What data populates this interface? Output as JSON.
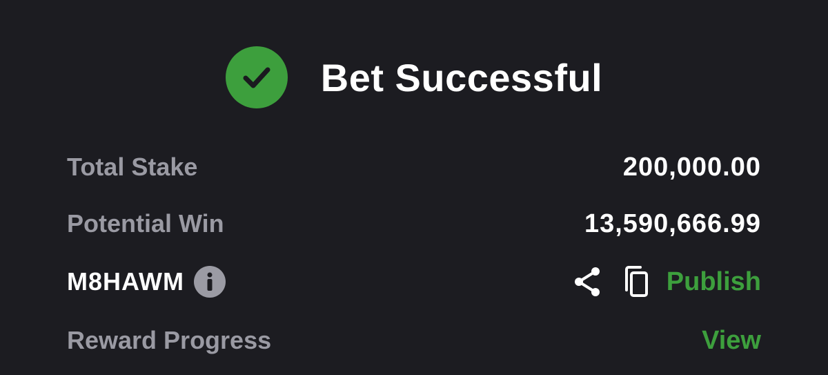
{
  "header": {
    "title": "Bet Successful",
    "icon": "check-circle-icon",
    "accent_color": "#3d9f3d"
  },
  "details": {
    "total_stake_label": "Total Stake",
    "total_stake_value": "200,000.00",
    "potential_win_label": "Potential Win",
    "potential_win_value": "13,590,666.99",
    "booking_code": "M8HAWM",
    "publish_label": "Publish",
    "reward_progress_label": "Reward Progress",
    "view_label": "View"
  },
  "icons": {
    "info": "info-icon",
    "share": "share-icon",
    "copy": "copy-icon"
  },
  "colors": {
    "background": "#1c1c21",
    "label": "#9a9aa3",
    "value": "#ffffff",
    "link": "#3d9f3d"
  }
}
